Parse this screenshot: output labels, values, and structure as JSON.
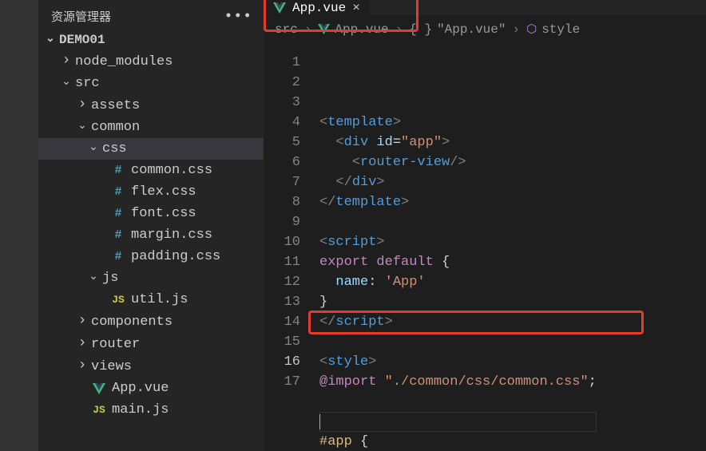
{
  "sidebar": {
    "title": "资源管理器",
    "project": "DEMO01",
    "items": [
      {
        "label": "node_modules",
        "chev": "right",
        "icon": "",
        "indent": 28
      },
      {
        "label": "src",
        "chev": "down",
        "icon": "",
        "indent": 28
      },
      {
        "label": "assets",
        "chev": "right",
        "icon": "",
        "indent": 48
      },
      {
        "label": "common",
        "chev": "down",
        "icon": "",
        "indent": 48
      },
      {
        "label": "css",
        "chev": "down",
        "icon": "",
        "indent": 62,
        "selected": true
      },
      {
        "label": "common.css",
        "chev": "",
        "icon": "hash",
        "indent": 90
      },
      {
        "label": "flex.css",
        "chev": "",
        "icon": "hash",
        "indent": 90
      },
      {
        "label": "font.css",
        "chev": "",
        "icon": "hash",
        "indent": 90
      },
      {
        "label": "margin.css",
        "chev": "",
        "icon": "hash",
        "indent": 90
      },
      {
        "label": "padding.css",
        "chev": "",
        "icon": "hash",
        "indent": 90
      },
      {
        "label": "js",
        "chev": "down",
        "icon": "",
        "indent": 62
      },
      {
        "label": "util.js",
        "chev": "",
        "icon": "js",
        "indent": 90
      },
      {
        "label": "components",
        "chev": "right",
        "icon": "",
        "indent": 48
      },
      {
        "label": "router",
        "chev": "right",
        "icon": "",
        "indent": 48
      },
      {
        "label": "views",
        "chev": "right",
        "icon": "",
        "indent": 48
      },
      {
        "label": "App.vue",
        "chev": "",
        "icon": "vue",
        "indent": 66
      },
      {
        "label": "main.js",
        "chev": "",
        "icon": "js",
        "indent": 66
      }
    ]
  },
  "tab": {
    "label": "App.vue"
  },
  "breadcrumbs": {
    "a": "src",
    "b": "App.vue",
    "c": "\"App.vue\"",
    "d": "style"
  },
  "code": {
    "lines": [
      {
        "n": 1,
        "seg": [
          [
            "brkt",
            "<"
          ],
          [
            "tag",
            "template"
          ],
          [
            "brkt",
            ">"
          ]
        ]
      },
      {
        "n": 2,
        "seg": [
          [
            "plain",
            "  "
          ],
          [
            "brkt",
            "<"
          ],
          [
            "tag",
            "div"
          ],
          [
            "plain",
            " "
          ],
          [
            "attr",
            "id"
          ],
          [
            "plain",
            "="
          ],
          [
            "str",
            "\"app\""
          ],
          [
            "brkt",
            ">"
          ]
        ]
      },
      {
        "n": 3,
        "seg": [
          [
            "plain",
            "    "
          ],
          [
            "brkt",
            "<"
          ],
          [
            "tag",
            "router-view"
          ],
          [
            "brkt",
            "/>"
          ]
        ]
      },
      {
        "n": 4,
        "seg": [
          [
            "plain",
            "  "
          ],
          [
            "brkt",
            "</"
          ],
          [
            "tag",
            "div"
          ],
          [
            "brkt",
            ">"
          ]
        ]
      },
      {
        "n": 5,
        "seg": [
          [
            "brkt",
            "</"
          ],
          [
            "tag",
            "template"
          ],
          [
            "brkt",
            ">"
          ]
        ]
      },
      {
        "n": 6,
        "seg": []
      },
      {
        "n": 7,
        "seg": [
          [
            "brkt",
            "<"
          ],
          [
            "tag",
            "script"
          ],
          [
            "brkt",
            ">"
          ]
        ]
      },
      {
        "n": 8,
        "seg": [
          [
            "kw2",
            "export"
          ],
          [
            "plain",
            " "
          ],
          [
            "kw2",
            "default"
          ],
          [
            "plain",
            " {"
          ]
        ]
      },
      {
        "n": 9,
        "seg": [
          [
            "plain",
            "  "
          ],
          [
            "id",
            "name"
          ],
          [
            "plain",
            ": "
          ],
          [
            "str",
            "'App'"
          ]
        ]
      },
      {
        "n": 10,
        "seg": [
          [
            "plain",
            "}"
          ]
        ]
      },
      {
        "n": 11,
        "seg": [
          [
            "brkt",
            "</"
          ],
          [
            "tag",
            "script"
          ],
          [
            "brkt",
            ">"
          ]
        ]
      },
      {
        "n": 12,
        "seg": []
      },
      {
        "n": 13,
        "seg": [
          [
            "brkt",
            "<"
          ],
          [
            "tag",
            "style"
          ],
          [
            "brkt",
            ">"
          ]
        ]
      },
      {
        "n": 14,
        "seg": [
          [
            "at",
            "@import"
          ],
          [
            "plain",
            " "
          ],
          [
            "str",
            "\"./common/css/common.css\""
          ],
          [
            "plain",
            ";"
          ]
        ]
      },
      {
        "n": 15,
        "seg": []
      },
      {
        "n": 16,
        "seg": [],
        "current": true
      },
      {
        "n": 17,
        "seg": [
          [
            "sel",
            "#app"
          ],
          [
            "plain",
            " {"
          ]
        ]
      }
    ]
  }
}
